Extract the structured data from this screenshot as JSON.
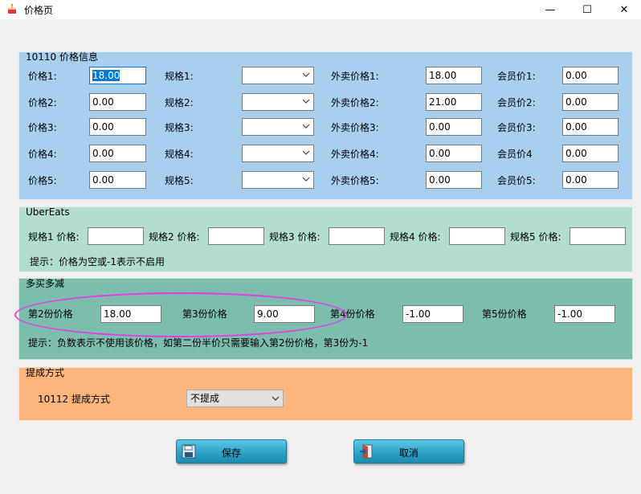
{
  "window": {
    "title": "价格页",
    "min_glyph": "—",
    "max_glyph": "☐",
    "close_glyph": "✕"
  },
  "price_info": {
    "legend": "10110 价格信息",
    "rows": [
      {
        "price_label": "价格1:",
        "price": "18.00",
        "spec_label": "规格1:",
        "spec": "",
        "takeout_label": "外卖价格1:",
        "takeout": "18.00",
        "member_label": "会员价1:",
        "member": "0.00"
      },
      {
        "price_label": "价格2:",
        "price": "0.00",
        "spec_label": "规格2:",
        "spec": "",
        "takeout_label": "外卖价格2:",
        "takeout": "21.00",
        "member_label": "会员价2:",
        "member": "0.00"
      },
      {
        "price_label": "价格3:",
        "price": "0.00",
        "spec_label": "规格3:",
        "spec": "",
        "takeout_label": "外卖价格3:",
        "takeout": "0.00",
        "member_label": "会员价3:",
        "member": "0.00"
      },
      {
        "price_label": "价格4:",
        "price": "0.00",
        "spec_label": "规格4:",
        "spec": "",
        "takeout_label": "外卖价格4:",
        "takeout": "0.00",
        "member_label": "会员价4",
        "member": "0.00"
      },
      {
        "price_label": "价格5:",
        "price": "0.00",
        "spec_label": "规格5:",
        "spec": "",
        "takeout_label": "外卖价格5:",
        "takeout": "0.00",
        "member_label": "会员价5:",
        "member": "0.00"
      }
    ]
  },
  "ubereats": {
    "legend": "UberEats",
    "fields": [
      {
        "label": "规格1 价格:",
        "value": ""
      },
      {
        "label": "规格2 价格:",
        "value": ""
      },
      {
        "label": "规格3 价格:",
        "value": ""
      },
      {
        "label": "规格4 价格:",
        "value": ""
      },
      {
        "label": "规格5 价格:",
        "value": ""
      }
    ],
    "hint": "提示：价格为空或-1表示不启用"
  },
  "multibuy": {
    "legend": "多买多减",
    "fields": [
      {
        "label": "第2份价格",
        "value": "18.00"
      },
      {
        "label": "第3份价格",
        "value": "9.00"
      },
      {
        "label": "第4份价格",
        "value": "-1.00"
      },
      {
        "label": "第5份价格",
        "value": "-1.00"
      }
    ],
    "hint": "提示：负数表示不使用该价格，如第二份半价只需要输入第2份价格，第3份为-1"
  },
  "commission": {
    "legend": "提成方式",
    "label": "10112 提成方式",
    "value": "不提成"
  },
  "buttons": {
    "save": "保存",
    "cancel": "取消"
  },
  "colors": {
    "annotation": "#e23fe3",
    "accent": "#0078d7",
    "button": "#2a9fc4"
  },
  "icons": {
    "app": "cake-icon",
    "save": "floppy-disk-icon",
    "cancel": "exit-door-icon",
    "dropdown": "chevron-down-icon"
  }
}
